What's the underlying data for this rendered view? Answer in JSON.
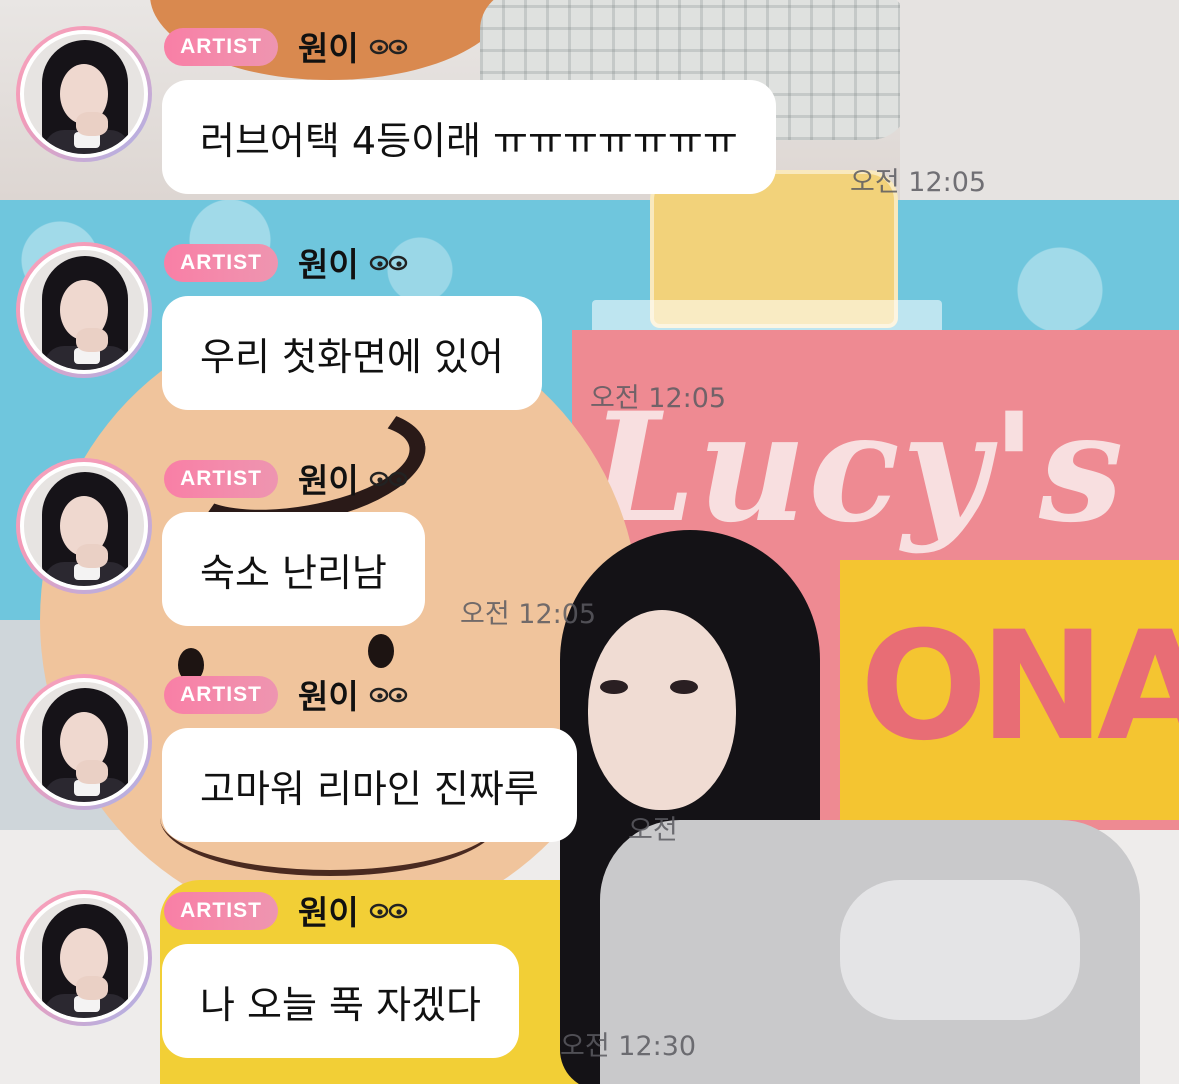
{
  "messages": [
    {
      "badge": "ARTIST",
      "sender": "원이",
      "text": "러브어택 4등이래 ㅠㅠㅠㅠㅠㅠㅠ",
      "time": "오전 12:05"
    },
    {
      "badge": "ARTIST",
      "sender": "원이",
      "text": "우리 첫화면에 있어",
      "time": "오전 12:05"
    },
    {
      "badge": "ARTIST",
      "sender": "원이",
      "text": "숙소 난리남",
      "time": "오전 12:05"
    },
    {
      "badge": "ARTIST",
      "sender": "원이",
      "text": "고마워 리마인 진짜루",
      "time": "오전"
    },
    {
      "badge": "ARTIST",
      "sender": "원이",
      "text": "나 오늘 푹 자겠다",
      "time": "오전 12:30"
    }
  ],
  "background_text": {
    "sign_top": "Lucy's",
    "sign_bottom": "ONA"
  },
  "icons": {
    "sender_suffix": "eyes-icon"
  },
  "colors": {
    "badge": "#f97fa6",
    "avatar_ring_start": "#f6a6c0",
    "avatar_ring_end": "#a9b5ea",
    "bubble": "#ffffff"
  }
}
